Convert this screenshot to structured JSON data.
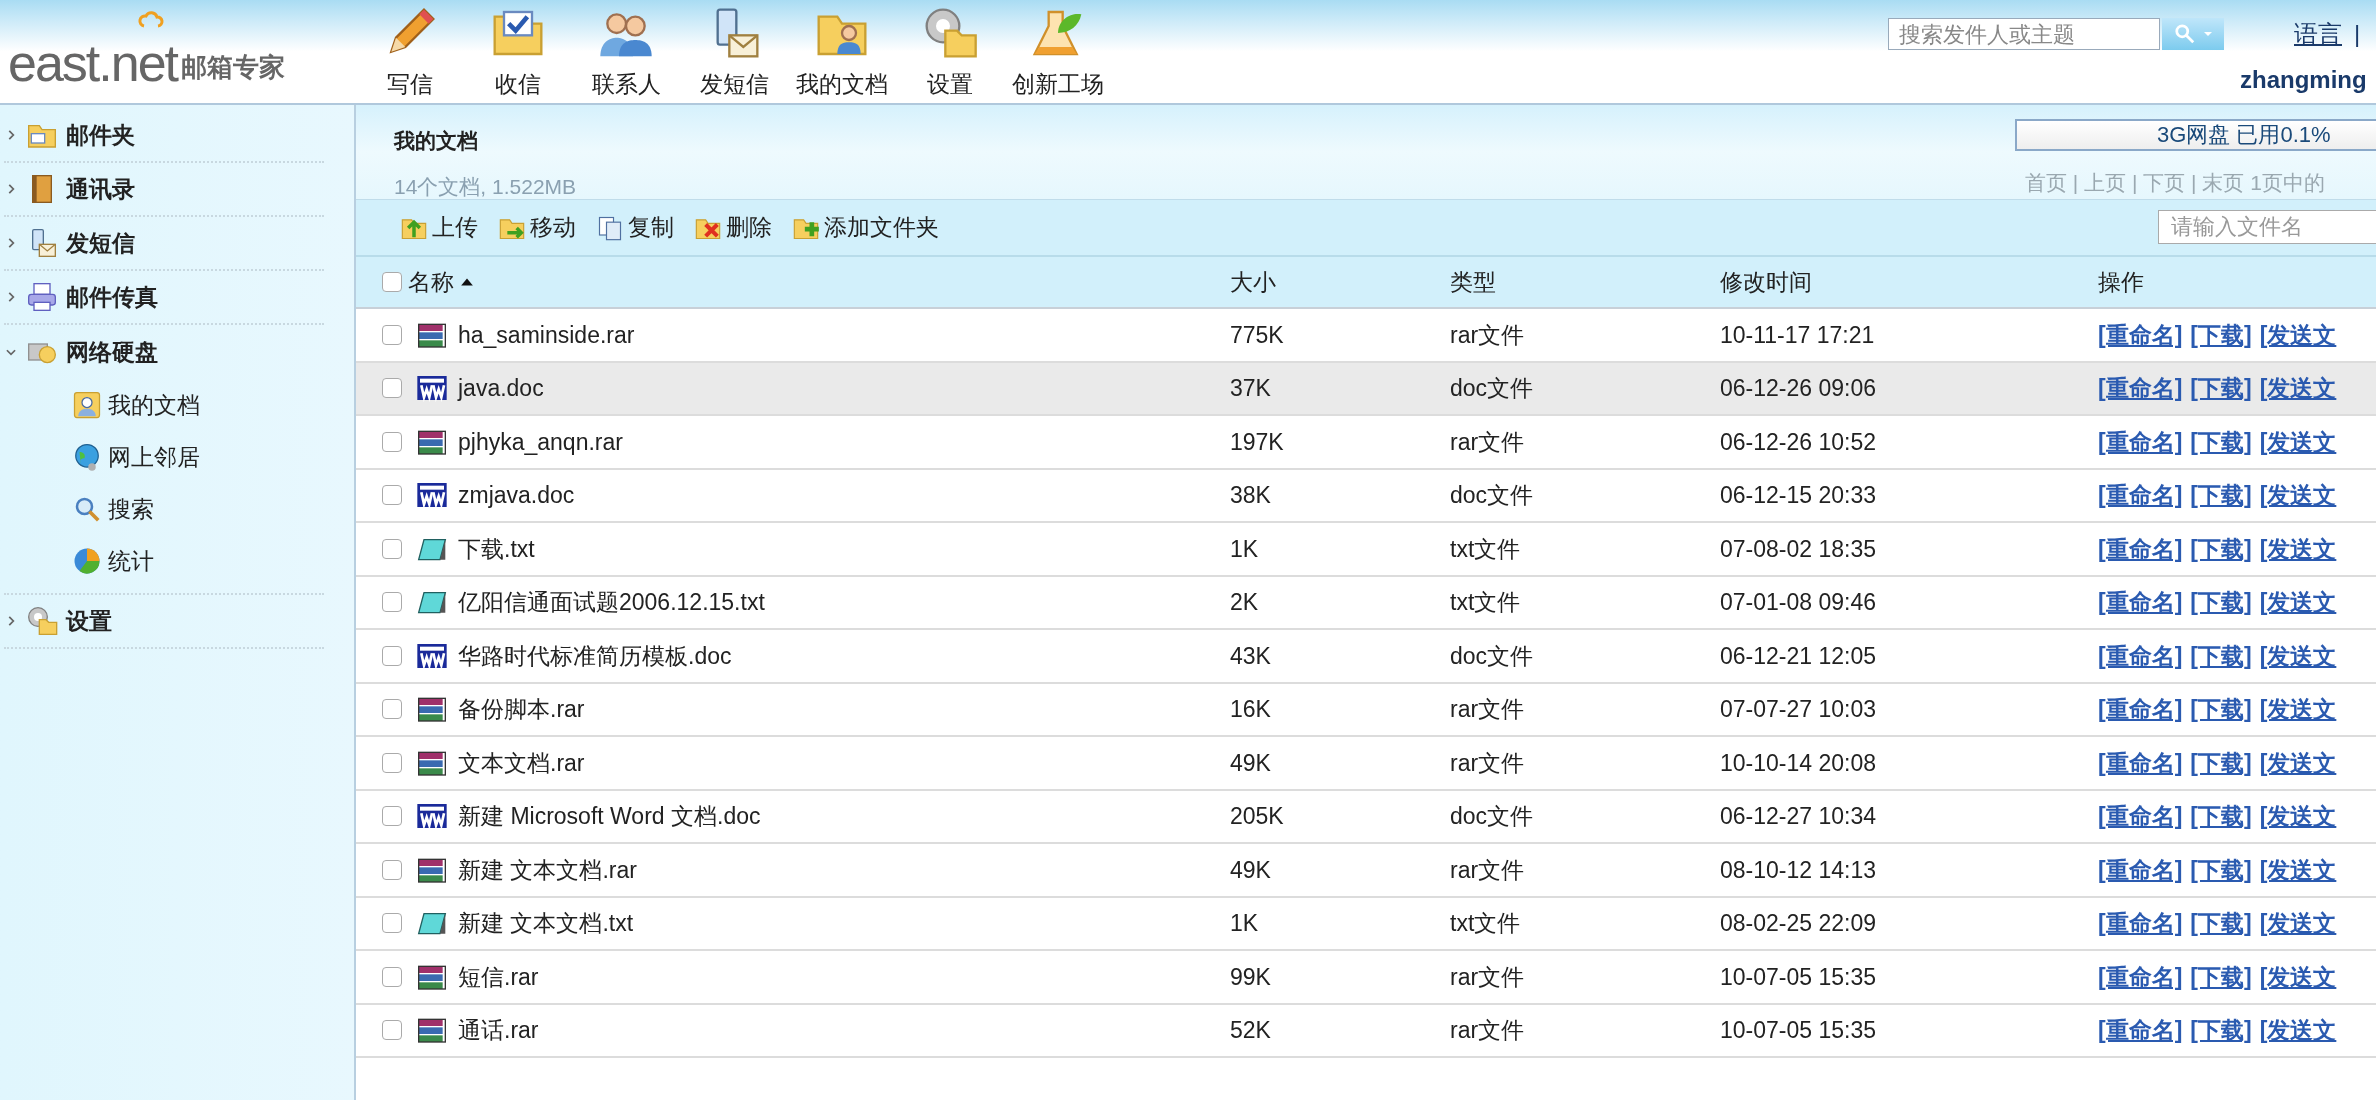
{
  "logo": {
    "brand": "east.net",
    "product": "邮箱专家"
  },
  "nav": [
    {
      "label": "写信"
    },
    {
      "label": "收信"
    },
    {
      "label": "联系人"
    },
    {
      "label": "发短信"
    },
    {
      "label": "我的文档"
    },
    {
      "label": "设置"
    },
    {
      "label": "创新工场"
    }
  ],
  "header_search": {
    "placeholder": "搜索发件人或主题"
  },
  "language_link": "语言",
  "separator": "|",
  "user": "zhangming",
  "sidebar": {
    "items": [
      {
        "label": "邮件夹",
        "expanded": false
      },
      {
        "label": "通讯录",
        "expanded": false
      },
      {
        "label": "发短信",
        "expanded": false
      },
      {
        "label": "邮件传真",
        "expanded": false
      },
      {
        "label": "网络硬盘",
        "expanded": true,
        "children": [
          {
            "label": "我的文档"
          },
          {
            "label": "网上邻居"
          },
          {
            "label": "搜索"
          },
          {
            "label": "统计"
          }
        ]
      },
      {
        "label": "设置",
        "expanded": false
      }
    ]
  },
  "folder": {
    "title": "我的文档",
    "summary": "14个文档, 1.522MB",
    "storage": "3G网盘 已用0.1%",
    "pager": "首页 | 上页 | 下页 | 末页 1页中的"
  },
  "toolbar": [
    {
      "label": "上传"
    },
    {
      "label": "移动"
    },
    {
      "label": "复制"
    },
    {
      "label": "删除"
    },
    {
      "label": "添加文件夹"
    }
  ],
  "file_search": {
    "placeholder": "请输入文件名"
  },
  "table": {
    "columns": [
      "名称",
      "大小",
      "类型",
      "修改时间",
      "操作"
    ],
    "select_all": {
      "checked": false
    },
    "rows": [
      {
        "name": "ha_saminside.rar",
        "kind": "rar",
        "size": "775K",
        "type": "rar文件",
        "modified": "10-11-17 17:21",
        "highlighted": false,
        "checked": false,
        "actions": [
          "[重命名]",
          "[下载]",
          "[发送文"
        ]
      },
      {
        "name": "java.doc",
        "kind": "doc",
        "size": "37K",
        "type": "doc文件",
        "modified": "06-12-26 09:06",
        "highlighted": true,
        "checked": false,
        "actions": [
          "[重命名]",
          "[下载]",
          "[发送文"
        ]
      },
      {
        "name": "pjhyka_anqn.rar",
        "kind": "rar",
        "size": "197K",
        "type": "rar文件",
        "modified": "06-12-26 10:52",
        "highlighted": false,
        "checked": false,
        "actions": [
          "[重命名]",
          "[下载]",
          "[发送文"
        ]
      },
      {
        "name": "zmjava.doc",
        "kind": "doc",
        "size": "38K",
        "type": "doc文件",
        "modified": "06-12-15 20:33",
        "highlighted": false,
        "checked": false,
        "actions": [
          "[重命名]",
          "[下载]",
          "[发送文"
        ]
      },
      {
        "name": "下载.txt",
        "kind": "txt",
        "size": "1K",
        "type": "txt文件",
        "modified": "07-08-02 18:35",
        "highlighted": false,
        "checked": false,
        "actions": [
          "[重命名]",
          "[下载]",
          "[发送文"
        ]
      },
      {
        "name": "亿阳信通面试题2006.12.15.txt",
        "kind": "txt",
        "size": "2K",
        "type": "txt文件",
        "modified": "07-01-08 09:46",
        "highlighted": false,
        "checked": false,
        "actions": [
          "[重命名]",
          "[下载]",
          "[发送文"
        ]
      },
      {
        "name": "华路时代标准简历模板.doc",
        "kind": "doc",
        "size": "43K",
        "type": "doc文件",
        "modified": "06-12-21 12:05",
        "highlighted": false,
        "checked": false,
        "actions": [
          "[重命名]",
          "[下载]",
          "[发送文"
        ]
      },
      {
        "name": "备份脚本.rar",
        "kind": "rar",
        "size": "16K",
        "type": "rar文件",
        "modified": "07-07-27 10:03",
        "highlighted": false,
        "checked": false,
        "actions": [
          "[重命名]",
          "[下载]",
          "[发送文"
        ]
      },
      {
        "name": "文本文档.rar",
        "kind": "rar",
        "size": "49K",
        "type": "rar文件",
        "modified": "10-10-14 20:08",
        "highlighted": false,
        "checked": false,
        "actions": [
          "[重命名]",
          "[下载]",
          "[发送文"
        ]
      },
      {
        "name": "新建 Microsoft Word 文档.doc",
        "kind": "doc",
        "size": "205K",
        "type": "doc文件",
        "modified": "06-12-27 10:34",
        "highlighted": false,
        "checked": false,
        "actions": [
          "[重命名]",
          "[下载]",
          "[发送文"
        ]
      },
      {
        "name": "新建 文本文档.rar",
        "kind": "rar",
        "size": "49K",
        "type": "rar文件",
        "modified": "08-10-12 14:13",
        "highlighted": false,
        "checked": false,
        "actions": [
          "[重命名]",
          "[下载]",
          "[发送文"
        ]
      },
      {
        "name": "新建 文本文档.txt",
        "kind": "txt",
        "size": "1K",
        "type": "txt文件",
        "modified": "08-02-25 22:09",
        "highlighted": false,
        "checked": false,
        "actions": [
          "[重命名]",
          "[下载]",
          "[发送文"
        ]
      },
      {
        "name": "短信.rar",
        "kind": "rar",
        "size": "99K",
        "type": "rar文件",
        "modified": "10-07-05 15:35",
        "highlighted": false,
        "checked": false,
        "actions": [
          "[重命名]",
          "[下载]",
          "[发送文"
        ]
      },
      {
        "name": "通话.rar",
        "kind": "rar",
        "size": "52K",
        "type": "rar文件",
        "modified": "10-07-05 15:35",
        "highlighted": false,
        "checked": false,
        "actions": [
          "[重命名]",
          "[下载]",
          "[发送文"
        ]
      }
    ]
  }
}
